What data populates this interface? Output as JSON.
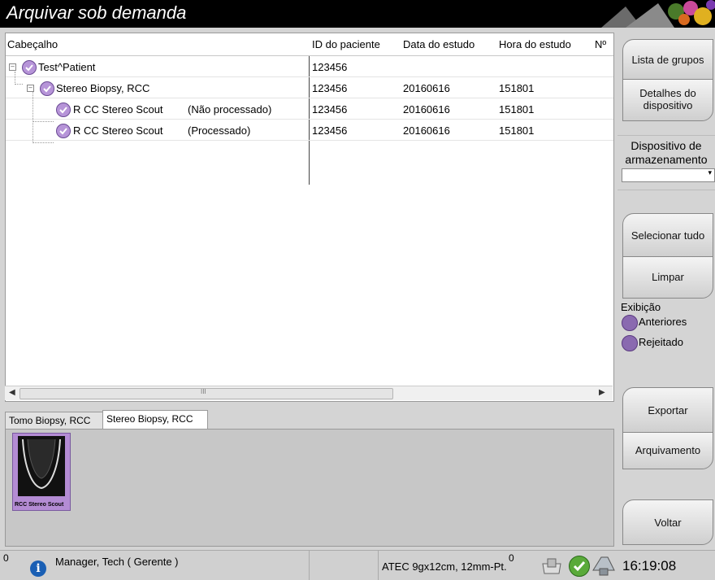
{
  "app": {
    "title": "Arquivar sob demanda"
  },
  "grid": {
    "columns": [
      "Cabeçalho",
      "ID do paciente",
      "Data do estudo",
      "Hora do estudo",
      "Nº"
    ],
    "rows": [
      {
        "name": "Test^Patient",
        "status": "",
        "patient_id": "123456",
        "date": "",
        "time": ""
      },
      {
        "name": "Stereo Biopsy, RCC",
        "status": "",
        "patient_id": "123456",
        "date": "20160616",
        "time": "151801"
      },
      {
        "name": "R CC Stereo Scout",
        "status": "(Não processado)",
        "patient_id": "123456",
        "date": "20160616",
        "time": "151801"
      },
      {
        "name": "R CC Stereo Scout",
        "status": "(Processado)",
        "patient_id": "123456",
        "date": "20160616",
        "time": "151801"
      }
    ],
    "scroll_mark": "III"
  },
  "tabs": [
    "Tomo Biopsy, RCC",
    "Stereo Biopsy, RCC"
  ],
  "active_tab": "Stereo Biopsy, RCC",
  "thumbnail": {
    "caption": "RCC Stereo Scout"
  },
  "sidebar": {
    "group_list": "Lista de grupos",
    "device_details": "Detalhes do dispositivo",
    "storage_device_label": "Dispositivo de armazenamento",
    "storage_device_value": "",
    "select_all": "Selecionar tudo",
    "clear": "Limpar",
    "display_label": "Exibição",
    "priors": "Anteriores",
    "rejected": "Rejeitado",
    "export": "Exportar",
    "archive": "Arquivamento",
    "back": "Voltar"
  },
  "status": {
    "count_left": "0",
    "user": "Manager, Tech ( Gerente )",
    "paddle": "ATEC 9gx12cm, 12mm-Pt.",
    "count_right": "0",
    "time": "16:19:08"
  },
  "colors": {
    "check": "#b694d8",
    "accent": "#1a5fb4"
  }
}
